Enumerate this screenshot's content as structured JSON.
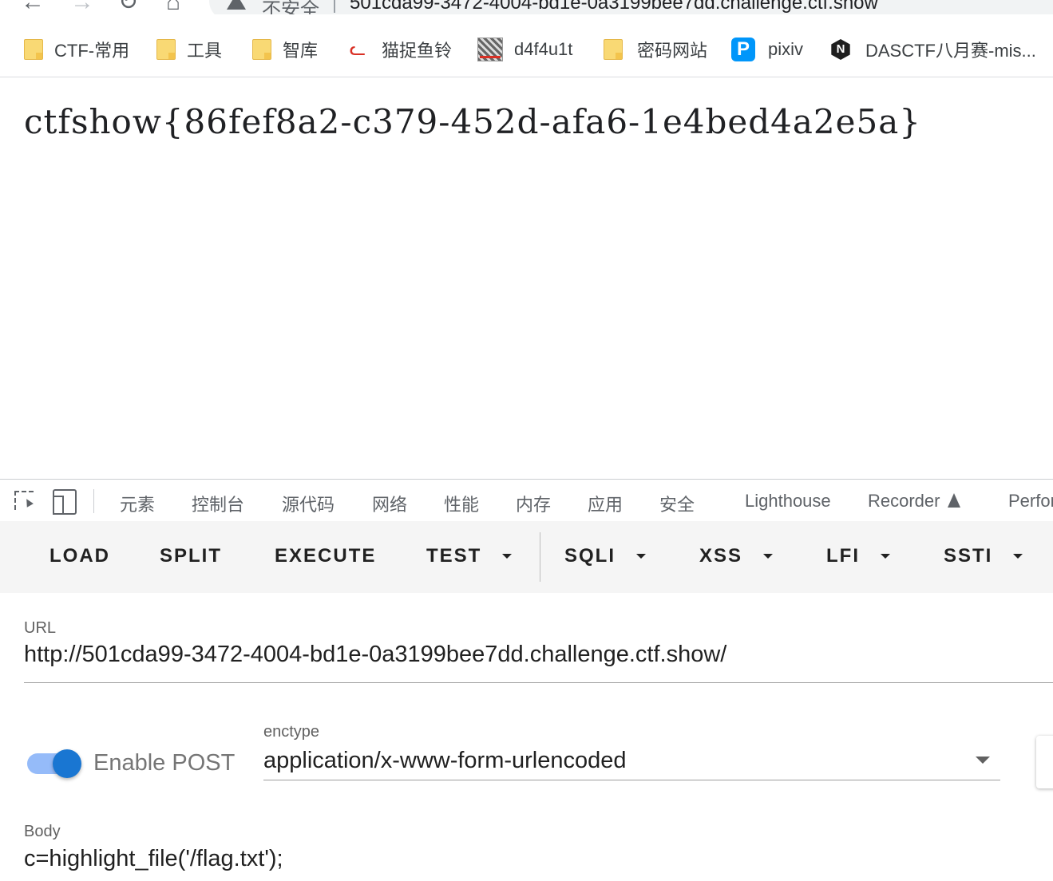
{
  "browser": {
    "nav_back": "←",
    "nav_forward": "→",
    "nav_reload": "↻",
    "nav_home": "⌂",
    "security_label": "不安全",
    "address": "501cda99-3472-4004-bd1e-0a3199bee7dd.challenge.ctf.show"
  },
  "bookmarks": [
    {
      "label": "CTF-常用",
      "icon": "folder-icon"
    },
    {
      "label": "工具",
      "icon": "folder-icon"
    },
    {
      "label": "智库",
      "icon": "folder-icon"
    },
    {
      "label": "猫捉鱼铃",
      "icon": "cat-icon"
    },
    {
      "label": "d4f4u1t",
      "icon": "image-icon"
    },
    {
      "label": "密码网站",
      "icon": "folder-icon"
    },
    {
      "label": "pixiv",
      "icon": "pixiv-icon"
    },
    {
      "label": "DASCTF八月赛-mis...",
      "icon": "n-icon"
    }
  ],
  "page": {
    "flag": "ctfshow{86fef8a2-c379-452d-afa6-1e4bed4a2e5a}"
  },
  "devtools": {
    "tabs": [
      "元素",
      "控制台",
      "源代码",
      "网络",
      "性能",
      "内存",
      "应用",
      "安全",
      "Lighthouse",
      "Recorder",
      "Perfor"
    ]
  },
  "hackbar": {
    "buttons": {
      "load": "LOAD",
      "split": "SPLIT",
      "execute": "EXECUTE",
      "test": "TEST",
      "sqli": "SQLI",
      "xss": "XSS",
      "lfi": "LFI",
      "ssti": "SSTI"
    },
    "url_label": "URL",
    "url_value": "http://501cda99-3472-4004-bd1e-0a3199bee7dd.challenge.ctf.show/",
    "post_enabled": true,
    "post_label": "Enable POST",
    "enctype_label": "enctype",
    "enctype_value": "application/x-www-form-urlencoded",
    "body_label": "Body",
    "body_value": "c=highlight_file('/flag.txt');",
    "accent_color": "#1976d2"
  }
}
